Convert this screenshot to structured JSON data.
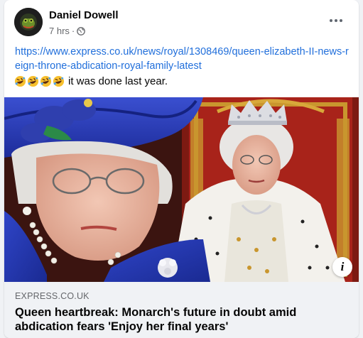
{
  "post": {
    "author_name": "Daniel Dowell",
    "time": "7 hrs",
    "separator": "·",
    "audience_icon": "globe-icon",
    "more_icon": "more-options-icon",
    "link_url": "https://www.express.co.uk/news/royal/1308469/queen-elizabeth-II-news-reign-throne-abdication-royal-family-latest",
    "emoji_icons": [
      "rolling-on-floor-laughing-icon",
      "rolling-on-floor-laughing-icon",
      "rolling-on-floor-laughing-icon",
      "rolling-on-floor-laughing-icon"
    ],
    "caption_text": "it was done last year."
  },
  "link_preview": {
    "domain": "EXPRESS.CO.UK",
    "title": "Queen heartbreak: Monarch's future in doubt amid abdication fears 'Enjoy her final years'",
    "info_label": "i"
  },
  "colors": {
    "link": "#216fdb",
    "secondary_text": "#65676b",
    "preview_bg": "#f0f2f5",
    "hat_blue": "#2a3fb8",
    "throne_red": "#b02016",
    "throne_gold": "#c9962e"
  }
}
